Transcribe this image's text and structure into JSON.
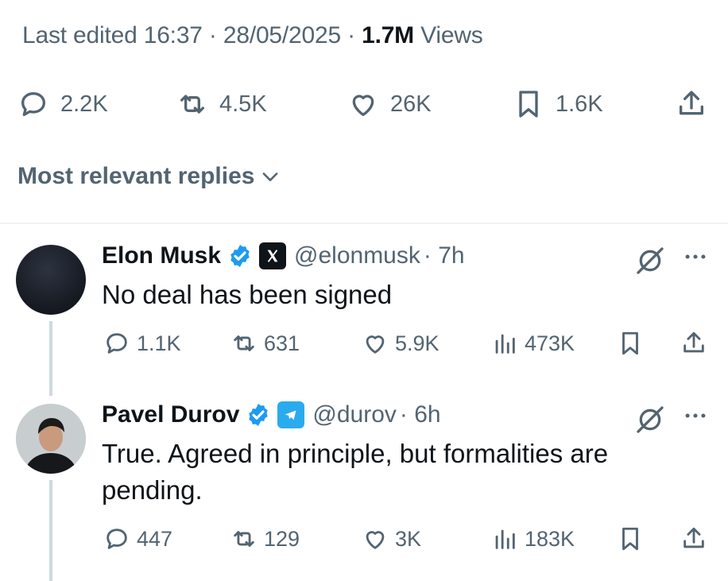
{
  "post": {
    "edited_label": "Last edited 16:37 · 28/05/2025",
    "views_count": "1.7M",
    "views_label": "Views",
    "actions": {
      "replies": "2.2K",
      "reposts": "4.5K",
      "likes": "26K",
      "bookmarks": "1.6K"
    }
  },
  "replies_sort": {
    "label": "Most relevant replies"
  },
  "replies": [
    {
      "name": "Elon Musk",
      "handle": "@elonmusk",
      "time": "· 7h",
      "affiliation": "X",
      "text_lines": [
        "No deal has been signed"
      ],
      "stats": {
        "replies": "1.1K",
        "reposts": "631",
        "likes": "5.9K",
        "views": "473K"
      }
    },
    {
      "name": "Pavel Durov",
      "handle": "@durov",
      "time": "· 6h",
      "affiliation": "Telegram",
      "text_lines": [
        "True. Agreed in principle, but formalities are",
        "pending."
      ],
      "stats": {
        "replies": "447",
        "reposts": "129",
        "likes": "3K",
        "views": "183K"
      }
    }
  ],
  "colors": {
    "muted": "#536471",
    "text": "#0f1419",
    "verified": "#1d9bf0",
    "telegram": "#2aabee"
  }
}
